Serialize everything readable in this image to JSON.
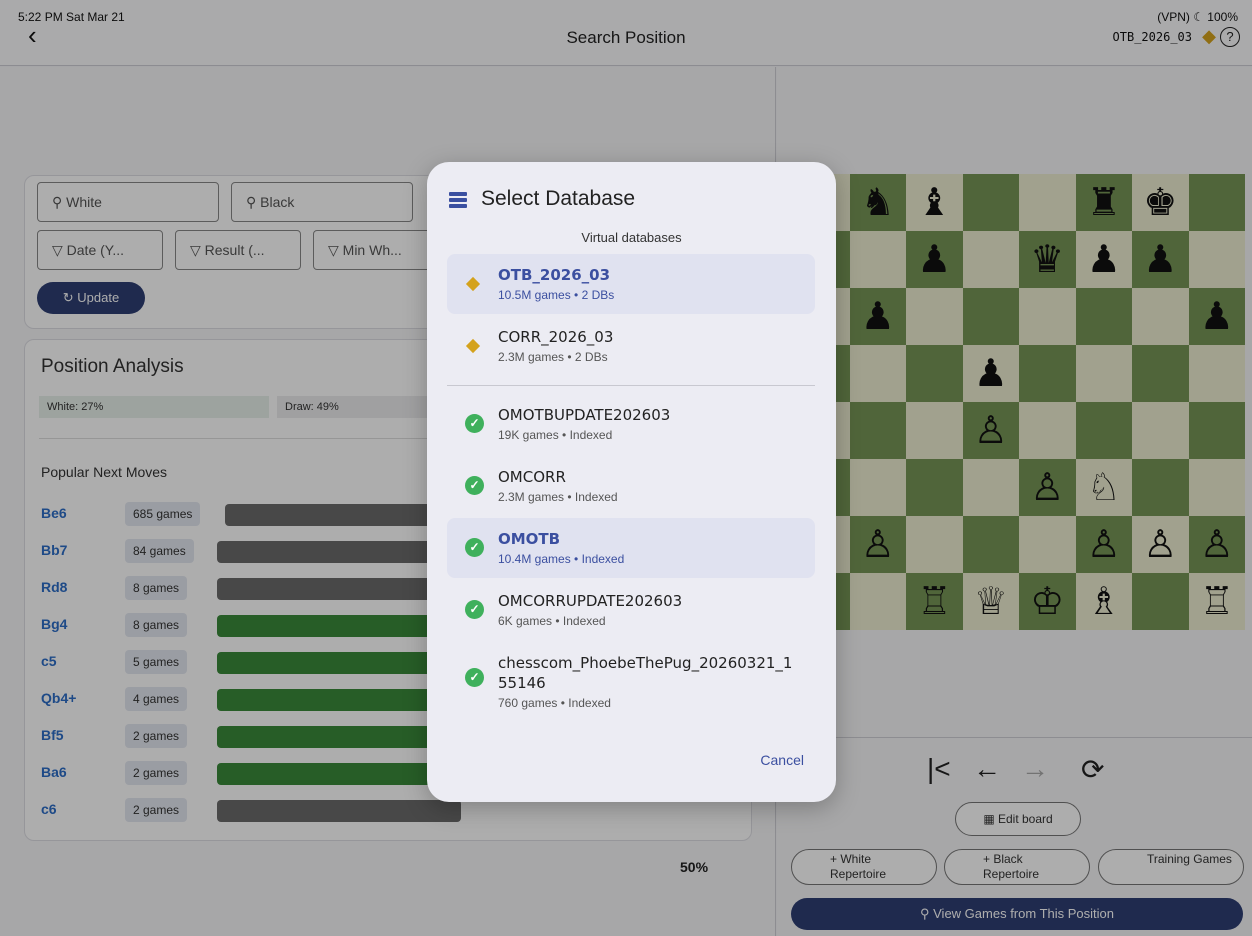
{
  "status": {
    "time": "5:22 PM  Sat Mar 21",
    "right": "(VPN) ☾ 100%"
  },
  "appbar": {
    "title": "Search Position",
    "db_label": "OTB_2026_03"
  },
  "filters": {
    "white": "White",
    "black": "Black",
    "date": "Date (Y...",
    "result": "Result (...",
    "min_white": "Min Wh...",
    "update": "Update"
  },
  "analysis": {
    "title": "Position Analysis",
    "white_stat": "White: 27%",
    "draw_stat": "Draw: 49%",
    "popular_title": "Popular Next Moves",
    "moves": [
      {
        "move": "Be6",
        "games": "685 games",
        "color": "#6a6a6a"
      },
      {
        "move": "Bb7",
        "games": "84 games",
        "color": "#6a6a6a"
      },
      {
        "move": "Rd8",
        "games": "8 games",
        "color": "#6a6a6a"
      },
      {
        "move": "Bg4",
        "games": "8 games",
        "color": "#3a8a3a"
      },
      {
        "move": "c5",
        "games": "5 games",
        "color": "#3a8a3a"
      },
      {
        "move": "Qb4+",
        "games": "4 games",
        "color": "#3a8a3a"
      },
      {
        "move": "Bf5",
        "games": "2 games",
        "color": "#3a8a3a"
      },
      {
        "move": "Ba6",
        "games": "2 games",
        "color": "#3a8a3a"
      },
      {
        "move": "c6",
        "games": "2 games",
        "color": "#6a6a6a"
      }
    ],
    "last_pct": "50%"
  },
  "board": {
    "light": "#eeeed2",
    "dark": "#769656",
    "rows": [
      [
        "",
        "♞",
        "♝",
        "",
        "",
        "♜",
        "♚",
        ""
      ],
      [
        "",
        "",
        "♟",
        "",
        "♛",
        "♟",
        "♟",
        ""
      ],
      [
        "",
        "♟",
        "",
        "",
        "",
        "",
        "",
        "♟"
      ],
      [
        "",
        "",
        "",
        "♟",
        "",
        "",
        "",
        ""
      ],
      [
        "",
        "",
        "",
        "♙",
        "",
        "",
        "",
        ""
      ],
      [
        "",
        "",
        "",
        "",
        "♙",
        "♘",
        "",
        ""
      ],
      [
        "",
        "♙",
        "",
        "",
        "",
        "♙",
        "♙",
        "♙"
      ],
      [
        "",
        "",
        "♖",
        "♕",
        "♔",
        "♗",
        "",
        "♖"
      ]
    ]
  },
  "controls": {
    "first": "|<",
    "back": "←",
    "forward": "→",
    "flip": "⟳",
    "edit_board": "Edit board",
    "white_rep": "+ White Repertoire",
    "black_rep": "+ Black Repertoire",
    "training": "Training Games",
    "view_games": "View Games from This Position"
  },
  "dialog": {
    "title": "Select Database",
    "virtual_section": "Virtual databases",
    "virtual": [
      {
        "name": "OTB_2026_03",
        "sub": "10.5M games • 2 DBs",
        "selected": true
      },
      {
        "name": "CORR_2026_03",
        "sub": "2.3M games • 2 DBs",
        "selected": false
      }
    ],
    "databases": [
      {
        "name": "OMOTBUPDATE202603",
        "sub": "19K games • Indexed",
        "selected": false
      },
      {
        "name": "OMCORR",
        "sub": "2.3M games • Indexed",
        "selected": false
      },
      {
        "name": "OMOTB",
        "sub": "10.4M games • Indexed",
        "selected": true
      },
      {
        "name": "OMCORRUPDATE202603",
        "sub": "6K games • Indexed",
        "selected": false
      },
      {
        "name": "chesscom_PhoebeThePug_20260321_1",
        "name2": "55146",
        "sub": "760 games • Indexed",
        "selected": false
      }
    ],
    "cancel": "Cancel"
  }
}
